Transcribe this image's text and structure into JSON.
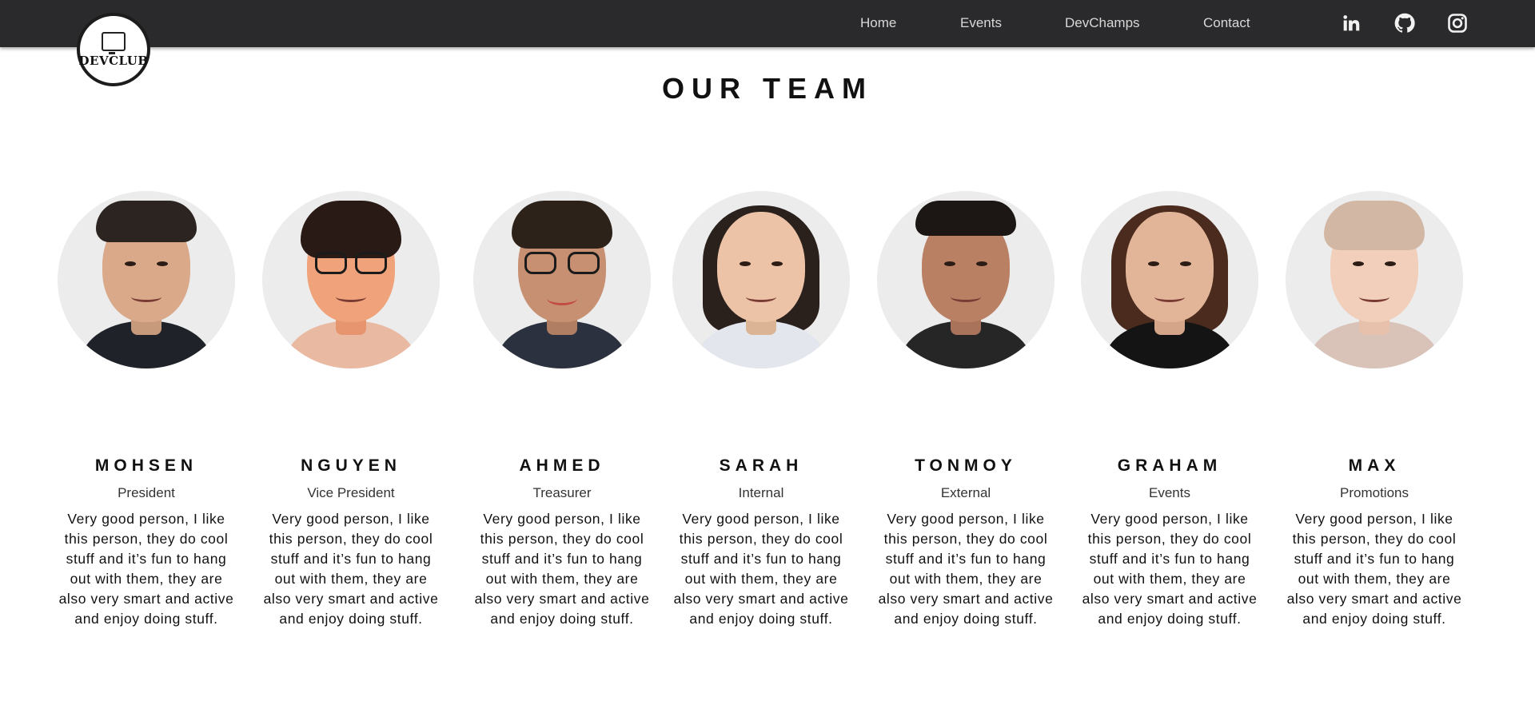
{
  "header": {
    "logo_text": "DEVCLUB",
    "nav": [
      {
        "label": "Home"
      },
      {
        "label": "Events"
      },
      {
        "label": "DevChamps"
      },
      {
        "label": "Contact"
      }
    ],
    "social": [
      "linkedin-icon",
      "github-icon",
      "instagram-icon"
    ]
  },
  "page": {
    "title": "OUR TEAM"
  },
  "team": [
    {
      "name": "MOHSEN",
      "role": "President",
      "bio": "Very good person, I like this person, they do cool stuff and it’s fun to hang out with them, they are also very smart and active and enjoy doing stuff."
    },
    {
      "name": "NGUYEN",
      "role": "Vice President",
      "bio": "Very good person, I like this person, they do cool stuff and it’s fun to hang out with them, they are also very smart and active and enjoy doing stuff."
    },
    {
      "name": "AHMED",
      "role": "Treasurer",
      "bio": "Very good person, I like this person, they do cool stuff and it’s fun to hang out with them, they are also very smart and active and enjoy doing stuff."
    },
    {
      "name": "SARAH",
      "role": "Internal",
      "bio": "Very good person, I like this person, they do cool stuff and it’s fun to hang out with them, they are also very smart and active and enjoy doing stuff."
    },
    {
      "name": "TONMOY",
      "role": "External",
      "bio": "Very good person, I like this person, they do cool stuff and it’s fun to hang out with them, they are also very smart and active and enjoy doing stuff."
    },
    {
      "name": "GRAHAM",
      "role": "Events",
      "bio": "Very good person, I like this person, they do cool stuff and it’s fun to hang out with them, they are also very smart and active and enjoy doing stuff."
    },
    {
      "name": "MAX",
      "role": "Promotions",
      "bio": "Very good person, I like this person, they do cool stuff and it’s fun to hang out with them, they are also very smart and active and enjoy doing stuff."
    }
  ],
  "colors": {
    "navbar_bg": "#2a2a2c",
    "nav_text": "#d8d8d8",
    "avatar_bg": "#ececec"
  }
}
